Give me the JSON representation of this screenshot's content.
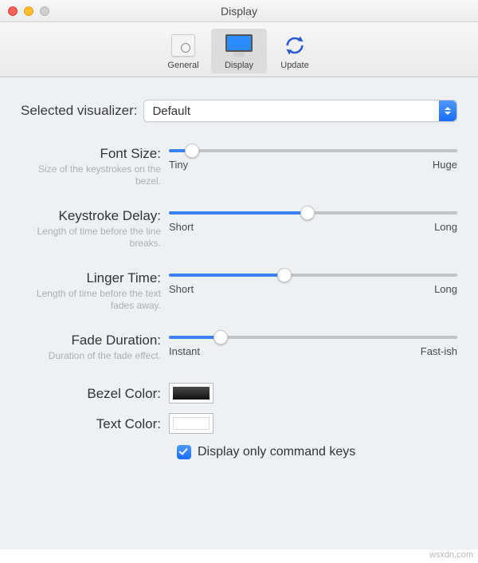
{
  "title": "Display",
  "tabs": {
    "general": "General",
    "display": "Display",
    "update": "Update"
  },
  "visualizer": {
    "label": "Selected visualizer:",
    "value": "Default"
  },
  "sliders": {
    "fontSize": {
      "label": "Font Size:",
      "help": "Size of the keystrokes on the bezel.",
      "min": "Tiny",
      "max": "Huge",
      "value": 8
    },
    "keystrokeDelay": {
      "label": "Keystroke Delay:",
      "help": "Length of time before the line breaks.",
      "min": "Short",
      "max": "Long",
      "value": 48
    },
    "lingerTime": {
      "label": "Linger Time:",
      "help": "Length of time before the text fades away.",
      "min": "Short",
      "max": "Long",
      "value": 40
    },
    "fadeDuration": {
      "label": "Fade Duration:",
      "help": "Duration of the fade effect.",
      "min": "Instant",
      "max": "Fast-ish",
      "value": 18
    }
  },
  "colors": {
    "bezel": {
      "label": "Bezel Color:"
    },
    "text": {
      "label": "Text Color:"
    }
  },
  "checkbox": {
    "label": "Display only command keys",
    "checked": true
  },
  "watermark": "wsxdn.com"
}
